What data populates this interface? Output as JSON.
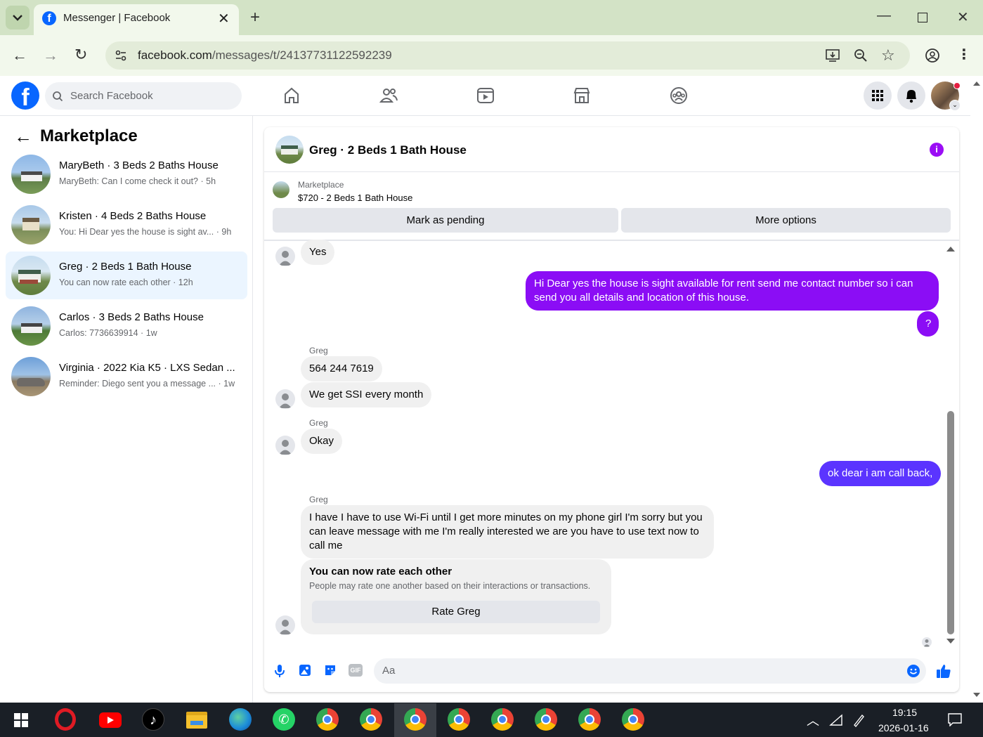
{
  "browser": {
    "tab_title": "Messenger | Facebook",
    "url_domain": "facebook.com",
    "url_path": "/messages/t/24137731122592239"
  },
  "fb": {
    "search_placeholder": "Search Facebook"
  },
  "left": {
    "heading": "Marketplace",
    "conversations": [
      {
        "title": "MaryBeth · 3 Beds 2 Baths House",
        "sub": "MaryBeth: Can I come check it out? · 5h"
      },
      {
        "title": "Kristen · 4 Beds 2 Baths House",
        "sub": "You: Hi Dear yes the house is sight av... · 9h"
      },
      {
        "title": "Greg · 2 Beds 1 Bath House",
        "sub": "You can now rate each other · 12h"
      },
      {
        "title": "Carlos · 3 Beds 2 Baths House",
        "sub": "Carlos: 7736639914 · 1w"
      },
      {
        "title": "Virginia · 2022 Kia K5 · LXS Sedan ...",
        "sub": "Reminder: Diego sent you a message ... · 1w"
      }
    ]
  },
  "chat": {
    "title": "Greg · 2 Beds 1 Bath House",
    "listing_label": "Marketplace",
    "listing_text": "$720 - 2 Beds 1 Bath House",
    "mark_pending": "Mark as pending",
    "more_options": "More options",
    "messages": {
      "yes": "Yes",
      "out1": "Hi Dear yes the house is sight available for rent send me contact number so i can send you all details and location of this house.",
      "out2": "?",
      "sender": "Greg",
      "phone": "564 244 7619",
      "ssi": "We get SSI every month",
      "okay": "Okay",
      "out3": "ok dear i am call back,",
      "long": "I have I have to use Wi-Fi until I get more minutes on my phone girl I'm sorry but you can leave message with me I'm really interested we are you have to use text now to call me"
    },
    "rate_title": "You can now rate each other",
    "rate_sub": "People may rate one another based on their interactions or transactions.",
    "rate_button": "Rate Greg",
    "composer_placeholder": "Aa"
  },
  "taskbar": {
    "time": "19:15",
    "date": "2026-01-16"
  },
  "colors": {
    "fb_blue": "#0866ff",
    "outgoing": "#8b0df5",
    "outgoing_late": "#5b34ff",
    "info_icon": "#9b0df5"
  }
}
